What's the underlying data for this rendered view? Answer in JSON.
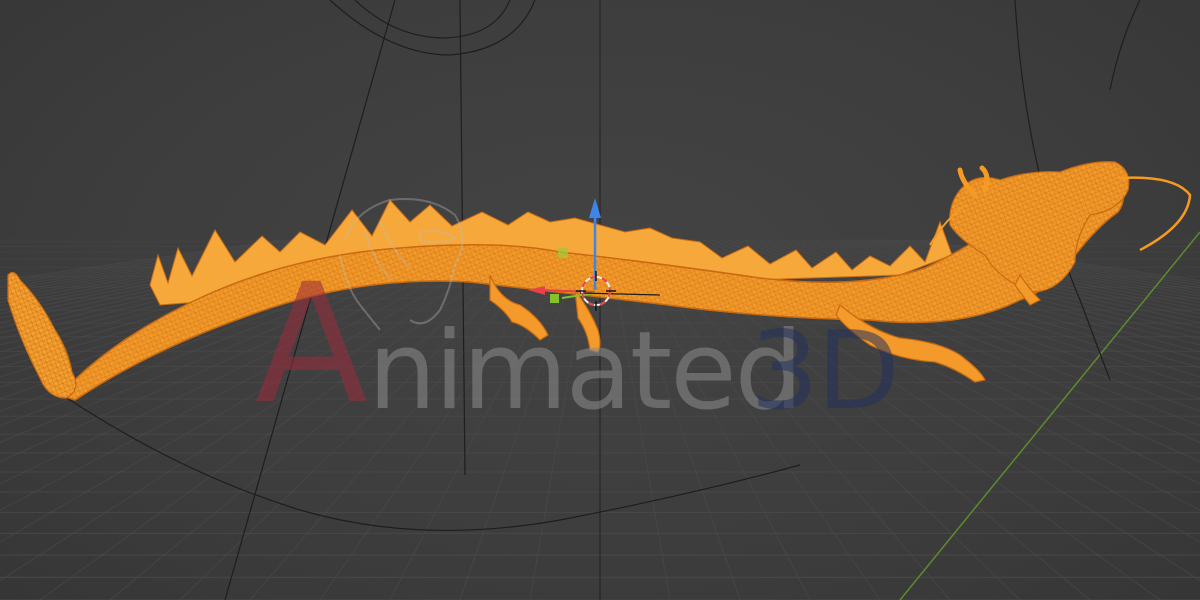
{
  "app": {
    "name": "3D viewport"
  },
  "viewport": {
    "mode": "wireframe",
    "background_color": "#3d3d3d",
    "grid_color": "#4a4a4a",
    "selection_color": "#f59a23"
  },
  "object": {
    "name": "dragon",
    "icon": "dragon-wireframe-icon",
    "selected": true
  },
  "gizmo": {
    "axis_colors": {
      "x": "#e8414a",
      "y": "#83c22c",
      "z": "#3d85e6"
    },
    "icons": [
      "move-gizmo-icon",
      "3d-cursor-icon"
    ]
  },
  "watermark": {
    "logo_icon": "eagle-head-logo-icon",
    "first_letter": "A",
    "middle_text": "nimated",
    "suffix_text": "3D",
    "colors": {
      "first": "#9c2b3c",
      "middle": "#8d8d8d",
      "suffix": "#23325f"
    }
  }
}
